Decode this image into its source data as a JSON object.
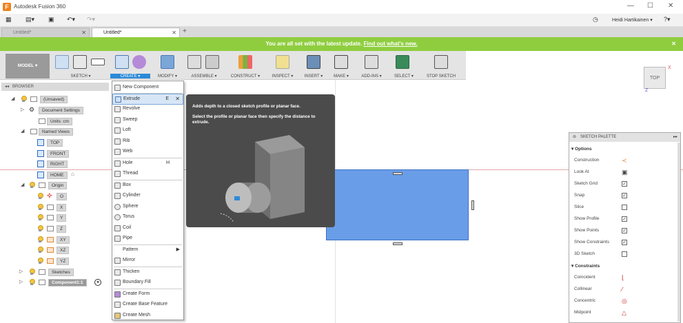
{
  "app": {
    "title": "Autodesk Fusion 360",
    "user": "Heidi Hartikainen ▾"
  },
  "tabs": [
    {
      "label": "Untitled*"
    },
    {
      "label": "Untitled*"
    }
  ],
  "banner": {
    "text": "You are all set with the latest update.",
    "link": "Find out what's new."
  },
  "toolbar": {
    "model": "MODEL ▾",
    "groups": [
      "SKETCH ▾",
      "CREATE ▾",
      "MODIFY ▾",
      "ASSEMBLE ▾",
      "CONSTRUCT ▾",
      "INSPECT ▾",
      "INSERT ▾",
      "MAKE ▾",
      "ADD-INS ▾",
      "SELECT ▾",
      "STOP SKETCH"
    ]
  },
  "browser": {
    "header": "BROWSER",
    "items": [
      "(Unsaved)",
      "Document Settings",
      "Units: cm",
      "Named Views",
      "TOP",
      "FRONT",
      "RIGHT",
      "HOME",
      "Origin",
      "O",
      "X",
      "Y",
      "Z",
      "XY",
      "XZ",
      "YZ",
      "Sketches",
      "Component1:1"
    ]
  },
  "create_menu": {
    "items": [
      {
        "label": "New Component"
      },
      {
        "label": "Extrude",
        "shortcut": "E"
      },
      {
        "label": "Revolve"
      },
      {
        "label": "Sweep"
      },
      {
        "label": "Loft"
      },
      {
        "label": "Rib"
      },
      {
        "label": "Web"
      },
      {
        "label": "Hole",
        "shortcut": "H"
      },
      {
        "label": "Thread"
      },
      {
        "label": "Box"
      },
      {
        "label": "Cylinder"
      },
      {
        "label": "Sphere"
      },
      {
        "label": "Torus"
      },
      {
        "label": "Coil"
      },
      {
        "label": "Pipe"
      },
      {
        "label": "Pattern"
      },
      {
        "label": "Mirror"
      },
      {
        "label": "Thicken"
      },
      {
        "label": "Boundary Fill"
      },
      {
        "label": "Create Form"
      },
      {
        "label": "Create Base Feature"
      },
      {
        "label": "Create Mesh"
      }
    ]
  },
  "tooltip": {
    "line1": "Adds depth to a closed sketch profile or planar face.",
    "line2": "Select the profile or planar face then specify the distance to extrude."
  },
  "palette": {
    "title": "SKETCH PALETTE",
    "options_header": "Options",
    "options": [
      {
        "label": "Construction",
        "kind": "icon"
      },
      {
        "label": "Look At",
        "kind": "icon"
      },
      {
        "label": "Sketch Grid",
        "kind": "checkbox",
        "checked": true
      },
      {
        "label": "Snap",
        "kind": "checkbox",
        "checked": true
      },
      {
        "label": "Slice",
        "kind": "checkbox",
        "checked": false
      },
      {
        "label": "Show Profile",
        "kind": "checkbox",
        "checked": true
      },
      {
        "label": "Show Points",
        "kind": "checkbox",
        "checked": true
      },
      {
        "label": "Show Constraints",
        "kind": "checkbox",
        "checked": true
      },
      {
        "label": "3D Sketch",
        "kind": "checkbox",
        "checked": false
      }
    ],
    "constraints_header": "Constraints",
    "constraints": [
      "Coincident",
      "Collinear",
      "Concentric",
      "Midpoint"
    ]
  },
  "viewcube": {
    "face": "TOP"
  },
  "colors": {
    "banner": "#8fcd3f",
    "selection": "#2c8ad8",
    "sketch_profile": "#6a9de8"
  }
}
